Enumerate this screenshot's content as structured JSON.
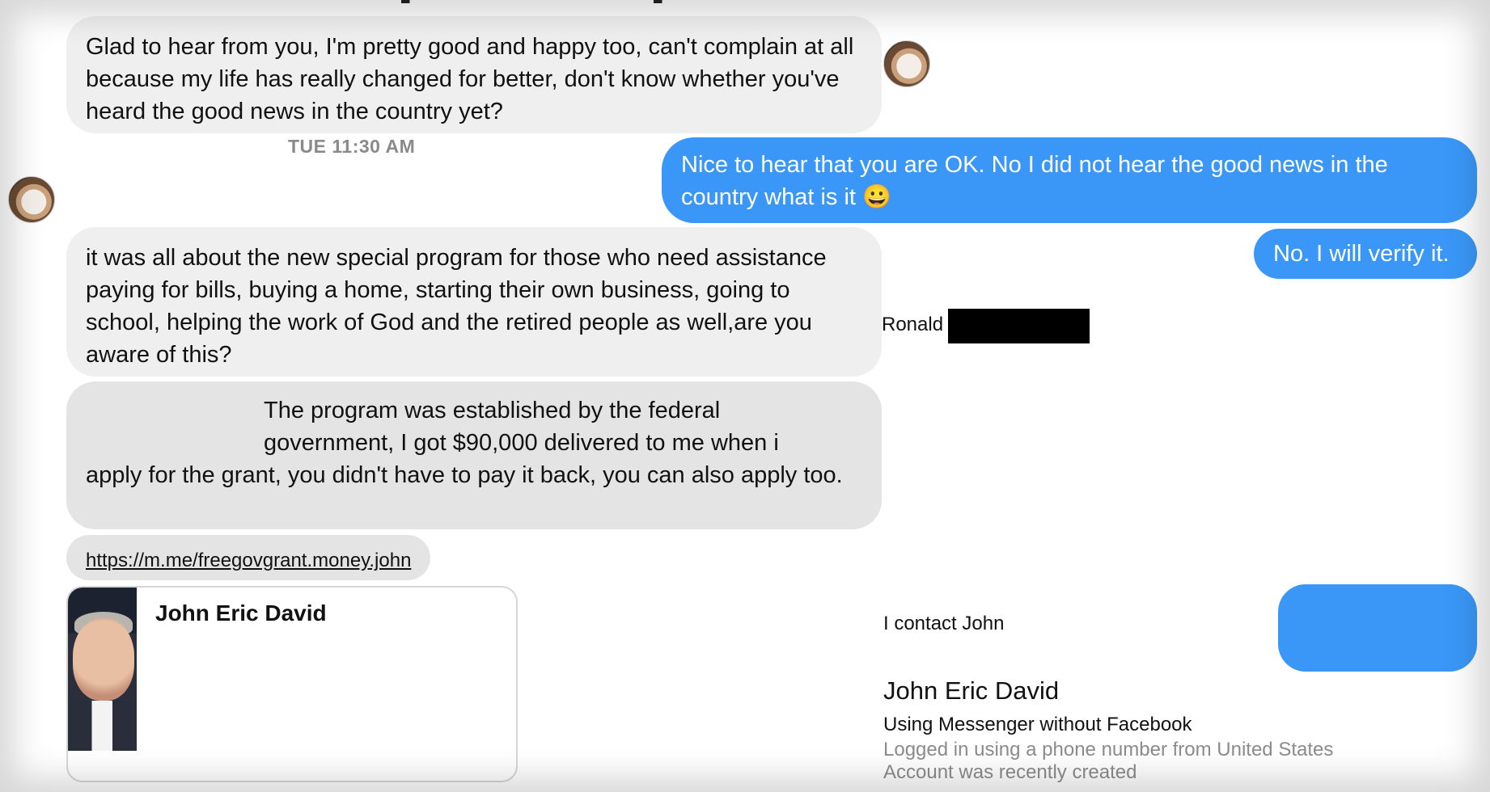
{
  "messages": {
    "m1": "Glad to hear from you, I'm pretty good and happy too, can't complain at all because my life has really changed for better, don't know whether you've heard the good news in the country yet?",
    "timestamp": "TUE 11:30 AM",
    "m2": "Nice to hear that you are OK. No I did not hear the good news in the country what is it",
    "m2_emoji": "😀",
    "m3": "it was all about the new special program for those who need assistance paying for bills, buying a home, starting their own business, going to school, helping the work of God and the retired people as well,are you aware of this?",
    "m4": "No. I will verify it.",
    "m5_line1": "The program was established by the federal",
    "m5_line2": "government, I got $90,000 delivered to me when i",
    "m5_rest": "apply for the grant, you didn't have to pay it back, you can also apply too.",
    "m6_link": "https://m.me/freegovgrant.money.john"
  },
  "annotations": {
    "ronald": "Ronald",
    "contact_note": "I contact John"
  },
  "card": {
    "name": "John Eric David"
  },
  "profile": {
    "name": "John Eric David",
    "line1": "Using Messenger without Facebook",
    "line2": "Logged in using a phone number from United States",
    "line3": "Account was recently created"
  },
  "colors": {
    "sent_bubble": "#3a97f7",
    "received_bubble": "#efeff0"
  }
}
